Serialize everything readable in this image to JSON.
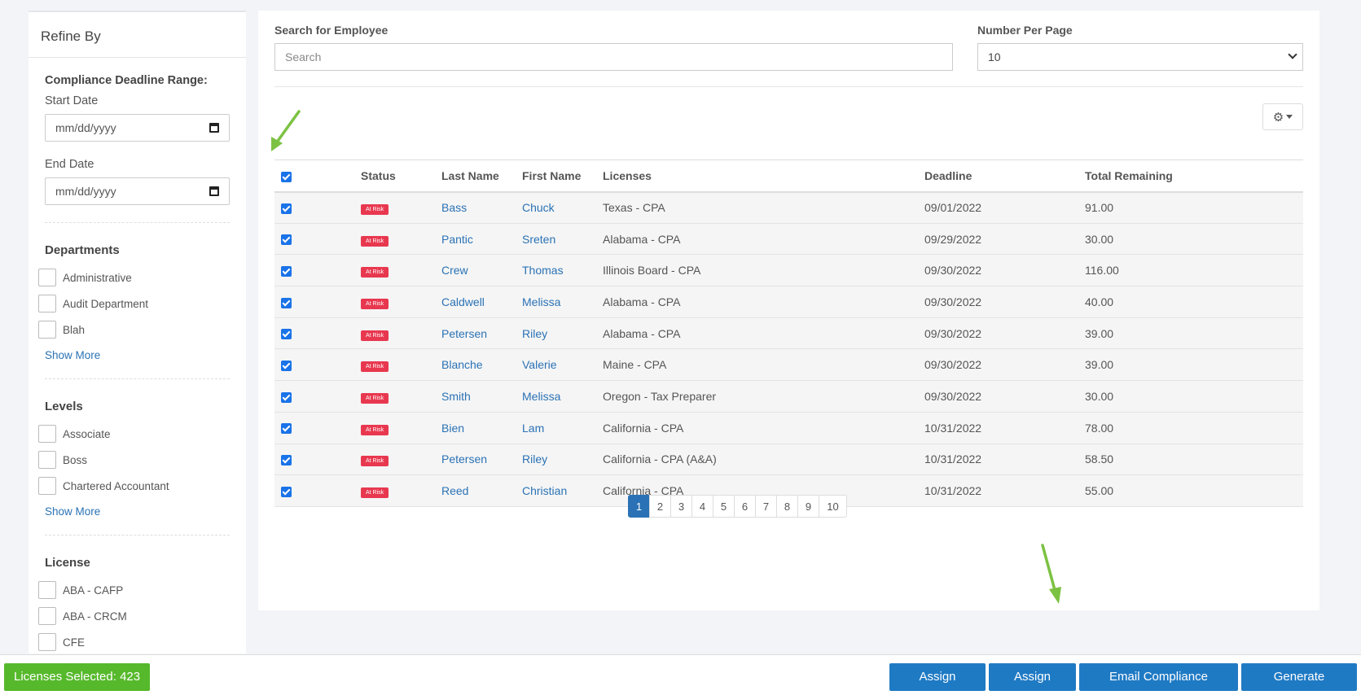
{
  "sidebar": {
    "title": "Refine By",
    "deadline_heading": "Compliance Deadline Range:",
    "start_label": "Start Date",
    "start_placeholder": "mm/dd/yyyy",
    "end_label": "End Date",
    "end_placeholder": "mm/dd/yyyy",
    "departments": {
      "title": "Departments",
      "items": [
        "Administrative",
        "Audit Department",
        "Blah"
      ],
      "show_more": "Show More"
    },
    "levels": {
      "title": "Levels",
      "items": [
        "Associate",
        "Boss",
        "Chartered Accountant"
      ],
      "show_more": "Show More"
    },
    "license": {
      "title": "License",
      "items": [
        "ABA - CAFP",
        "ABA - CRCM",
        "CFE"
      ]
    }
  },
  "main": {
    "search_label": "Search for Employee",
    "search_placeholder": "Search",
    "npp_label": "Number Per Page",
    "npp_value": "10",
    "gear_icon": "gear-icon",
    "columns": [
      "",
      "Status",
      "Last Name",
      "First Name",
      "Licenses",
      "Deadline",
      "Total Remaining"
    ],
    "rows": [
      {
        "status": "At Risk",
        "last": "Bass",
        "first": "Chuck",
        "license": "Texas - CPA",
        "deadline": "09/01/2022",
        "remaining": "91.00"
      },
      {
        "status": "At Risk",
        "last": "Pantic",
        "first": "Sreten",
        "license": "Alabama - CPA",
        "deadline": "09/29/2022",
        "remaining": "30.00"
      },
      {
        "status": "At Risk",
        "last": "Crew",
        "first": "Thomas",
        "license": "Illinois Board - CPA",
        "deadline": "09/30/2022",
        "remaining": "116.00"
      },
      {
        "status": "At Risk",
        "last": "Caldwell",
        "first": "Melissa",
        "license": "Alabama - CPA",
        "deadline": "09/30/2022",
        "remaining": "40.00"
      },
      {
        "status": "At Risk",
        "last": "Petersen",
        "first": "Riley",
        "license": "Alabama - CPA",
        "deadline": "09/30/2022",
        "remaining": "39.00"
      },
      {
        "status": "At Risk",
        "last": "Blanche",
        "first": "Valerie",
        "license": "Maine - CPA",
        "deadline": "09/30/2022",
        "remaining": "39.00"
      },
      {
        "status": "At Risk",
        "last": "Smith",
        "first": "Melissa",
        "license": "Oregon - Tax Preparer",
        "deadline": "09/30/2022",
        "remaining": "30.00"
      },
      {
        "status": "At Risk",
        "last": "Bien",
        "first": "Lam",
        "license": "California - CPA",
        "deadline": "10/31/2022",
        "remaining": "78.00"
      },
      {
        "status": "At Risk",
        "last": "Petersen",
        "first": "Riley",
        "license": "California - CPA (A&A)",
        "deadline": "10/31/2022",
        "remaining": "58.50"
      },
      {
        "status": "At Risk",
        "last": "Reed",
        "first": "Christian",
        "license": "California - CPA",
        "deadline": "10/31/2022",
        "remaining": "55.00"
      }
    ],
    "pages": [
      "1",
      "2",
      "3",
      "4",
      "5",
      "6",
      "7",
      "8",
      "9",
      "10"
    ]
  },
  "bottom": {
    "licenses_selected": "Licenses Selected: 423",
    "assign_course": "Assign Course",
    "assign_track": "Assign Track",
    "email_reports": "Email Compliance Reports",
    "generate_reports": "Generate Reports"
  },
  "colors": {
    "accent": "#1f7ac4",
    "success": "#56b92b",
    "danger": "#e8384f",
    "arrow": "#7cc242"
  }
}
